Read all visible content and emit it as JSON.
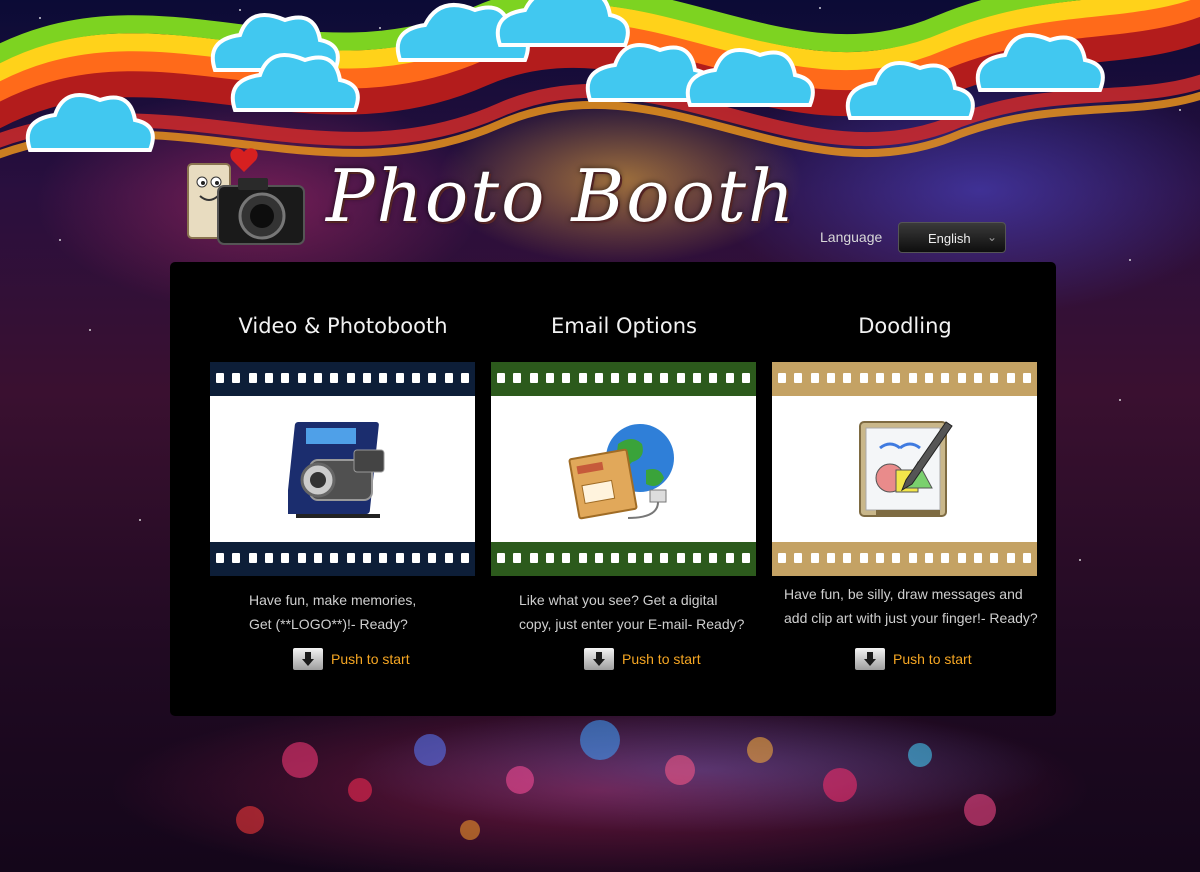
{
  "brand": {
    "title": "Photo Booth"
  },
  "language": {
    "label": "Language",
    "selected": "English"
  },
  "cards": [
    {
      "title": "Video & Photobooth",
      "desc": [
        "Have fun, make memories,",
        "Get (**LOGO**)!- Ready?"
      ],
      "button": "Push to start",
      "strip_color": "#0d1e38",
      "icon": "video-camera-icon"
    },
    {
      "title": "Email Options",
      "desc": [
        "Like what you see? Get a digital",
        "copy, just enter your E-mail- Ready?"
      ],
      "button": "Push to start",
      "strip_color": "#2c5a1c",
      "icon": "email-globe-icon"
    },
    {
      "title": "Doodling",
      "desc": [
        "Have fun, be silly, draw messages and",
        "add clip art with just your finger!- Ready?"
      ],
      "button": "Push to start",
      "strip_color": "#c4a264",
      "icon": "drawing-icon"
    }
  ],
  "colors": {
    "accent": "#f5a623",
    "panel": "#000000"
  }
}
